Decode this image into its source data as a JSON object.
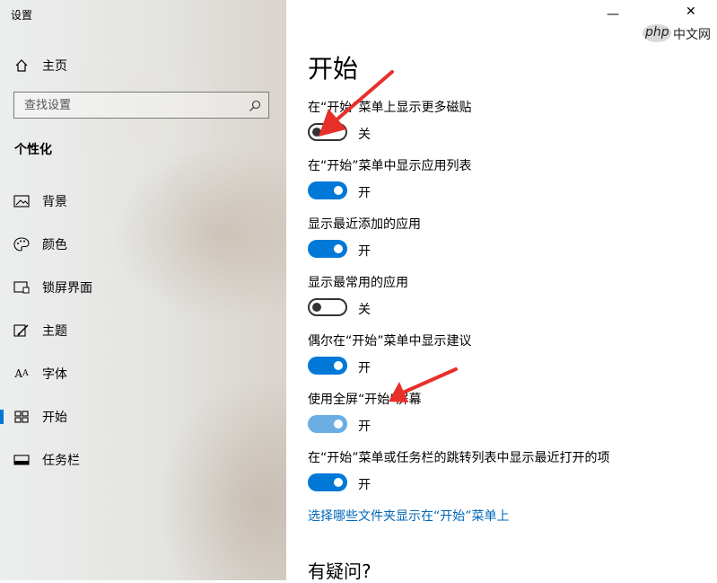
{
  "window": {
    "title": "设置",
    "controls": {
      "minimize": "—",
      "maximize": "☐",
      "close": "✕"
    }
  },
  "watermark": {
    "text1": "php",
    "text2": "中文网"
  },
  "sidebar": {
    "home_label": "主页",
    "search_placeholder": "查找设置",
    "section_title": "个性化",
    "items": [
      {
        "label": "背景",
        "icon": "picture-icon"
      },
      {
        "label": "颜色",
        "icon": "palette-icon"
      },
      {
        "label": "锁屏界面",
        "icon": "lock-screen-icon"
      },
      {
        "label": "主题",
        "icon": "theme-icon"
      },
      {
        "label": "字体",
        "icon": "font-icon"
      },
      {
        "label": "开始",
        "icon": "start-icon",
        "active": true
      },
      {
        "label": "任务栏",
        "icon": "taskbar-icon"
      }
    ]
  },
  "main": {
    "title": "开始",
    "settings": [
      {
        "label": "在“开始”菜单上显示更多磁贴",
        "state": "关"
      },
      {
        "label": "在“开始”菜单中显示应用列表",
        "state": "开"
      },
      {
        "label": "显示最近添加的应用",
        "state": "开"
      },
      {
        "label": "显示最常用的应用",
        "state": "关"
      },
      {
        "label": "偶尔在“开始”菜单中显示建议",
        "state": "开"
      },
      {
        "label": "使用全屏“开始”屏幕",
        "state": "开"
      },
      {
        "label": "在“开始”菜单或任务栏的跳转列表中显示最近打开的项",
        "state": "开"
      }
    ],
    "link": "选择哪些文件夹显示在“开始”菜单上",
    "question": "有疑问?"
  },
  "colors": {
    "accent": "#0078d7",
    "accent_light": "#6aaee3",
    "link": "#0067b8",
    "annotation_arrow": "#e8302b"
  }
}
